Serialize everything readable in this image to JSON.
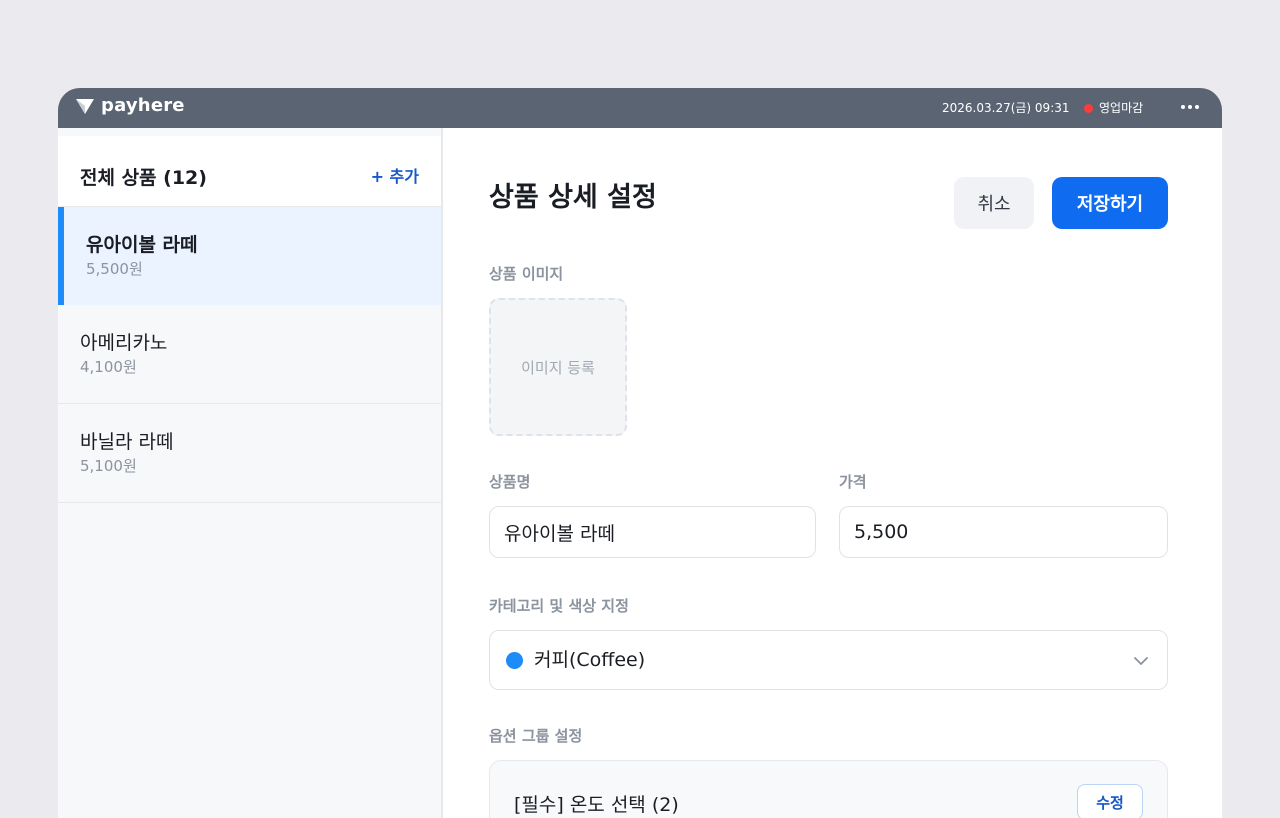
{
  "topbar": {
    "brand": "payhere",
    "datetime": "2026.03.27(금) 09:31",
    "status": "영업마감",
    "status_color": "#ff3b3b",
    "more_icon": "more-horizontal-icon"
  },
  "sidebar": {
    "title": "전체 상품 (12)",
    "add_label": "+ 추가",
    "accent_color": "#1d8cf8",
    "items": [
      {
        "name": "유아이볼 라떼",
        "price": "5,500원",
        "active": true
      },
      {
        "name": "아메리카노",
        "price": "4,100원",
        "active": false
      },
      {
        "name": "바닐라 라떼",
        "price": "5,100원",
        "active": false
      }
    ]
  },
  "main": {
    "title": "상품 상세 설정",
    "cancel_label": "취소",
    "save_label": "저장하기",
    "image_label": "상품 이미지",
    "image_upload_label": "이미지 등록",
    "name_label": "상품명",
    "name_value": "유아이볼 라떼",
    "price_label": "가격",
    "price_value": "5,500",
    "category_label": "카테고리 및 색상 지정",
    "category_value": "커피(Coffee)",
    "category_color": "#1d8cf8",
    "option_label": "옵션 그룹 설정",
    "option_groups": [
      {
        "text": "[필수] 온도 선택 (2)",
        "edit_label": "수정"
      }
    ]
  },
  "colors": {
    "primary": "#0f6cf0",
    "topbar": "#5a6472",
    "background": "#ebebef"
  }
}
